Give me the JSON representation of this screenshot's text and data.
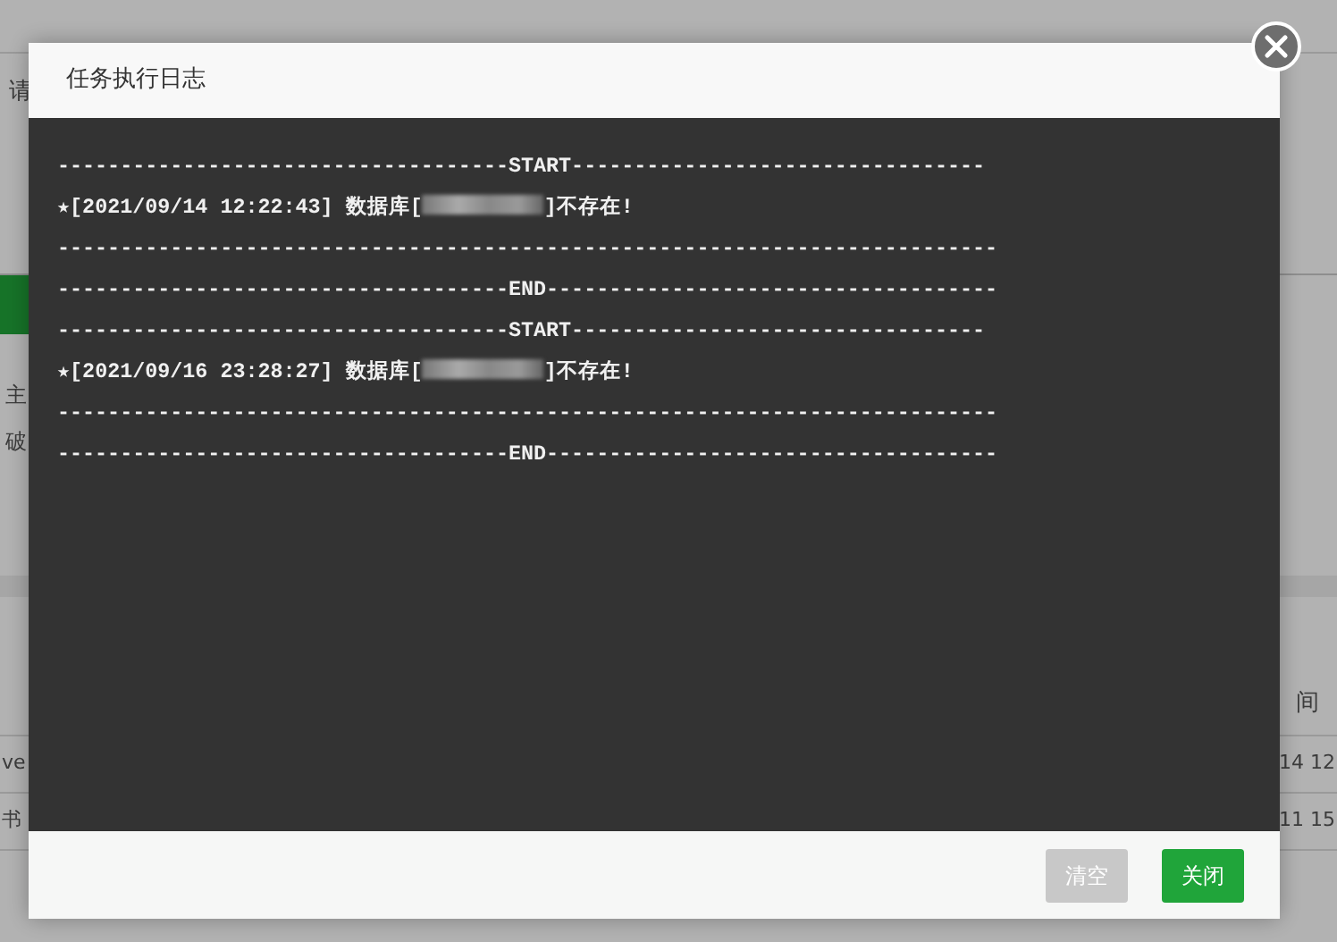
{
  "background_page": {
    "search_label": "请",
    "side_texts": [
      "主",
      "破"
    ],
    "table_header": "间",
    "rows": [
      {
        "left": "ve",
        "right": "14 12"
      },
      {
        "left": "书",
        "right": "11 15"
      }
    ]
  },
  "dialog": {
    "title": "任务执行日志",
    "log_lines": [
      {
        "kind": "rule",
        "text": "------------------------------------START---------------------------------"
      },
      {
        "kind": "entry",
        "before": "★[2021/09/14 12:22:43] 数据库[",
        "redacted": true,
        "after": "]不存在!"
      },
      {
        "kind": "rule",
        "text": "---------------------------------------------------------------------------"
      },
      {
        "kind": "rule",
        "text": "------------------------------------END------------------------------------"
      },
      {
        "kind": "rule",
        "text": "------------------------------------START---------------------------------"
      },
      {
        "kind": "entry",
        "before": "★[2021/09/16 23:28:27] 数据库[",
        "redacted": true,
        "after": "]不存在!"
      },
      {
        "kind": "rule",
        "text": "---------------------------------------------------------------------------"
      },
      {
        "kind": "rule",
        "text": "------------------------------------END------------------------------------"
      }
    ],
    "buttons": [
      {
        "label": "清空",
        "kind": "secondary"
      },
      {
        "label": "关闭",
        "kind": "primary"
      }
    ]
  }
}
